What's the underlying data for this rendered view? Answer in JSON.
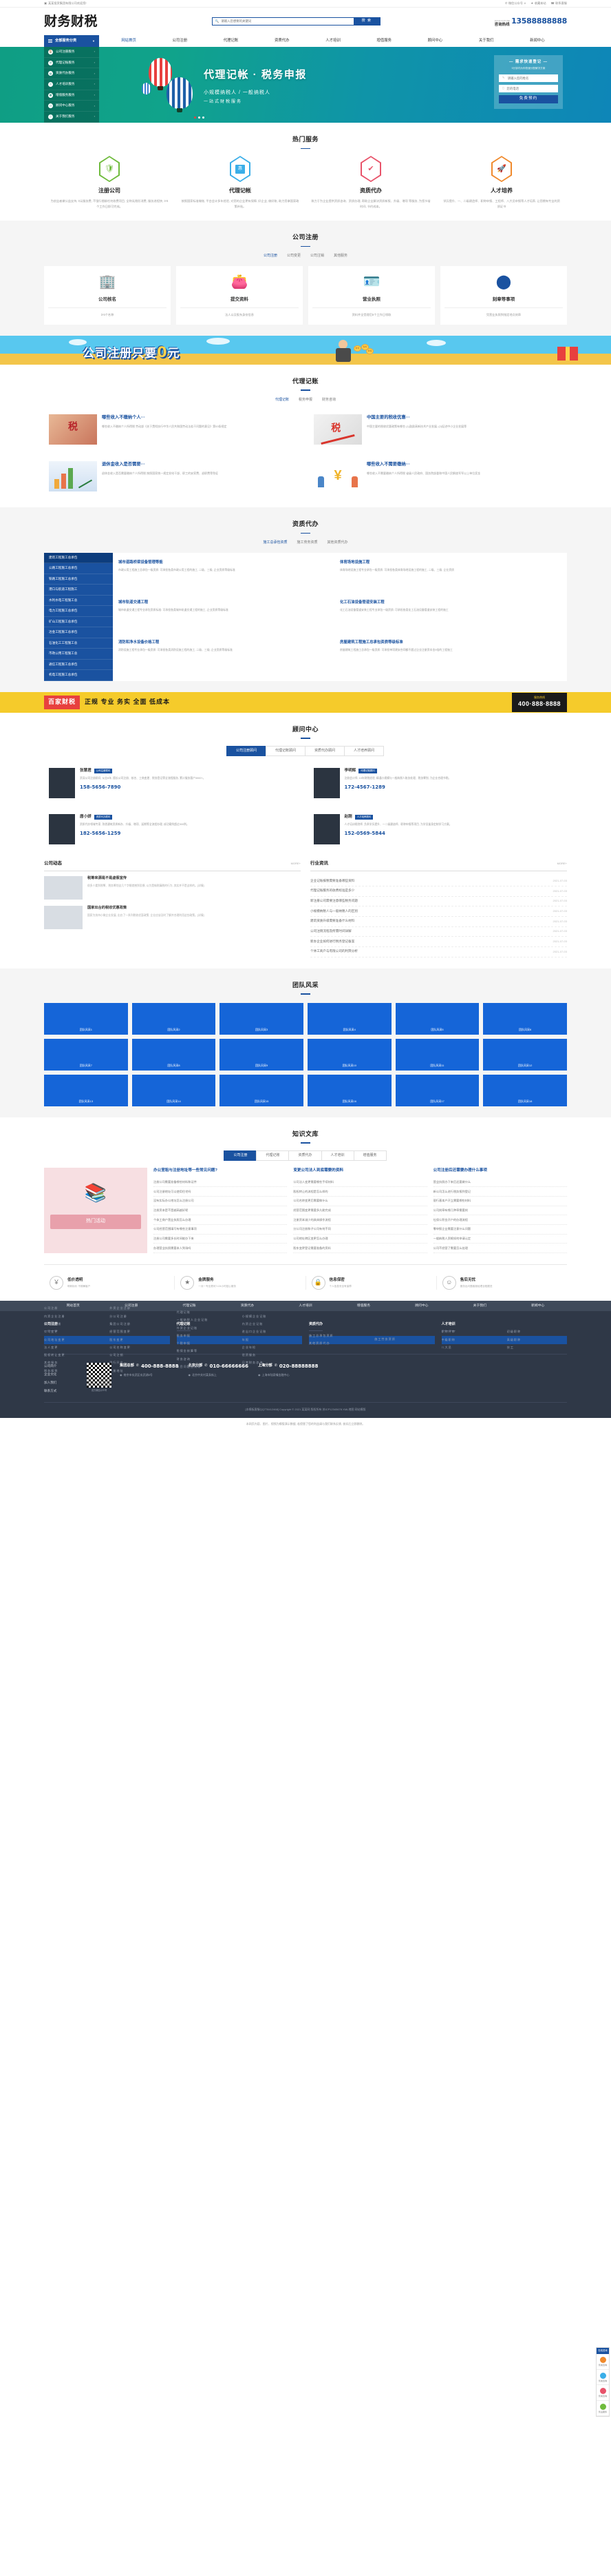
{
  "topbar": {
    "welcome": "某某投资集团有限公司欢迎您!",
    "links": [
      {
        "label": "微信公众号",
        "icon": "wechat-icon",
        "caret": "∨"
      },
      {
        "label": "收藏本站",
        "icon": "star-icon"
      },
      {
        "label": "联系客服",
        "icon": "headset-icon"
      }
    ]
  },
  "header": {
    "logo": "财务财税",
    "search": {
      "placeholder": "请输入您想要的关键词",
      "button": "搜 索",
      "icon": "search-icon"
    },
    "hotline": {
      "en": "ADICE HOTLINE",
      "cn": "咨询热线",
      "number": "13588888888"
    }
  },
  "nav": {
    "category_button": "全部服务分类",
    "links": [
      {
        "label": "网站首页",
        "active": true
      },
      {
        "label": "公司注册"
      },
      {
        "label": "代理记账"
      },
      {
        "label": "资质代办"
      },
      {
        "label": "人才培训"
      },
      {
        "label": "增值服务"
      },
      {
        "label": "顾问中心"
      },
      {
        "label": "关于我们"
      },
      {
        "label": "新闻中心"
      }
    ]
  },
  "hero": {
    "categories": [
      {
        "label": "公司注册服务",
        "icon": "building-icon"
      },
      {
        "label": "代理记账服务",
        "icon": "ledger-icon"
      },
      {
        "label": "资质代办服务",
        "icon": "certificate-icon"
      },
      {
        "label": "人才培训服务",
        "icon": "person-icon"
      },
      {
        "label": "增值服务服务",
        "icon": "grid-icon"
      },
      {
        "label": "顾问中心服务",
        "icon": "advisor-icon"
      },
      {
        "label": "关于我们服务",
        "icon": "info-icon"
      }
    ],
    "title": "代理记帐 · 税务申报",
    "subtitle": "小规模纳税人 / 一般纳税人",
    "subtitle2": "一站式财税服务",
    "form": {
      "title": "— 需求快速登记 —",
      "tip": "5分钟内为你快速分配解决方案",
      "name_placeholder": "请输入您的姓名",
      "phone_placeholder": "您的电话",
      "submit": "免费预约",
      "name_icon": "pen-icon",
      "phone_icon": "phone-icon"
    },
    "dots": 3
  },
  "hot_services": {
    "title": "热门服务",
    "items": [
      {
        "name": "注册公司",
        "icon": "shield-icon",
        "glyph": "🛡",
        "color": "#6fbb3c",
        "desc": "为创业者做公益支持, 0元服务费, 不强行捆绑任何收费项目, 全称无隐形消费, 服务进程快, 3-5个工作日即可完成。"
      },
      {
        "name": "代理记帐",
        "icon": "ticket-icon",
        "glyph": "惠",
        "color": "#3aaee8",
        "desc": "按照国家标准做账, 平台会计多年经验, 对您的企业更有保障, 好企业, 做好账, 助力您拿国家政策补贴。"
      },
      {
        "name": "资质代办",
        "icon": "medal-icon",
        "glyph": "✔",
        "color": "#e8536a",
        "desc": "致力于为企业提供资质咨询、资质办理, 帮助企业解决资质新报、升级、增项 等服务, 为您节省时间, 节约成本。"
      },
      {
        "name": "人才培养",
        "icon": "rocket-icon",
        "glyph": "🚀",
        "color": "#f08a2c",
        "desc": "学历提升、一、二级建造师、职称申报、工程师、八大员申报等人才培养, 让您拥有专业的资质证书"
      }
    ]
  },
  "company_register": {
    "title": "公司注册",
    "tabs": [
      "公司注册",
      "公司变更",
      "公司注销",
      "其他服务"
    ],
    "cards": [
      {
        "title": "公司核名",
        "desc": "3-5个名称",
        "icon": "building-icon",
        "glyph": "🏢"
      },
      {
        "title": "提交资料",
        "desc": "法人以及股东身份信息",
        "icon": "wallet-icon",
        "glyph": "👛"
      },
      {
        "title": "营业执照",
        "desc": "资料齐全受理后5个工作日领取",
        "icon": "license-icon",
        "glyph": "🪪"
      },
      {
        "title": "刻章等事项",
        "desc": "凭营业执照到指定地点刻章",
        "icon": "stamp-icon",
        "glyph": "🏷"
      }
    ]
  },
  "promo_banner": {
    "text_main": "公司注册只要",
    "text_zero": "0",
    "text_unit": "元"
  },
  "bookkeeping": {
    "title": "代理记账",
    "tabs": [
      "代理记账",
      "税务申报",
      "财务咨询"
    ],
    "articles": [
      {
        "title": "哪些收入不缴纳个人···",
        "desc": "哪些收入不缴纳个人所得税 劳动部《关于贯彻执行中华人民共和国劳动法若干问题的意见》第53条规定",
        "thumb": "hands-tax-image"
      },
      {
        "title": "中国主要的税收优惠···",
        "desc": "中国主要的税收优惠政策有哪些 (1)鼓励高新技术产业发展; (2)促进中小企业发展等",
        "thumb": "tax-climb-image"
      },
      {
        "title": "退休金收入是否需要···",
        "desc": "退休金收入是否需要缴纳个人所得税 按照国家统一规定发给干部、职工的安家费、退职费等免征",
        "thumb": "growth-chart-image"
      },
      {
        "title": "哪些收入不需要缴纳···",
        "desc": "哪些收入不需要缴纳个人所得税 省级人民政府、国务院部委和中国人民解放军军以上单位奖金",
        "thumb": "yen-people-image"
      }
    ]
  },
  "qualification": {
    "title": "资质代办",
    "tabs": [
      "施工总承包资质",
      "施工劳务资质",
      "其他资质代办"
    ],
    "left_menu": [
      {
        "label": "建筑工程施工总承包",
        "active": true
      },
      {
        "label": "公路工程施工总承包"
      },
      {
        "label": "铁路工程施工总承包"
      },
      {
        "label": "港口与航道工程施工"
      },
      {
        "label": "水利水电工程施工总"
      },
      {
        "label": "电力工程施工总承包"
      },
      {
        "label": "矿山工程施工总承包"
      },
      {
        "label": "冶金工程施工总承包"
      },
      {
        "label": "石油化工工程施工总"
      },
      {
        "label": "市政公用工程施工总"
      },
      {
        "label": "通信工程施工总承包"
      },
      {
        "label": "机电工程施工总承包"
      }
    ],
    "items": [
      {
        "title": "城市道路桥梁设备管理等能",
        "desc": "市政公用工程施工总承包一级资质: 可承担各类市政公用工程的施工, 二级、三级, 企业资质等级标准"
      },
      {
        "title": "体育场地设施工程",
        "desc": "体育场地设施工程专业承包一级资质: 可承担各类体育场地设施工程的施工, 二级、三级, 企业资质"
      },
      {
        "title": "城市轨道交通工程",
        "desc": "城市轨道交通工程专业承包资质标准: 可承担各类城市轨道交通工程的施工, 企业资质等级标准"
      },
      {
        "title": "化工石油设备管道安装工程",
        "desc": "化工石油设备管道安装工程专业承包一级资质: 可承担各类化工石油设备管道安装工程的施工"
      },
      {
        "title": "消防和净水设备价格工程",
        "desc": "消防设施工程专业承包一级资质: 可承担各类消防设施工程的施工, 二级、三级, 企业资质等级标准"
      },
      {
        "title": "房屋建筑工程施工总承包资质等级标准",
        "desc": "房屋建筑工程施工总承包一级资质: 可承担单项建安合同额不超过企业注册资本金5倍的工程施工"
      }
    ]
  },
  "brand_bar": {
    "logo": "百家财税",
    "slogan": "正规 专业 务实 全面 低成本",
    "hotline_label": "服务热线",
    "hotline_number": "400·888·8888"
  },
  "consultants": {
    "title": "顾问中心",
    "tabs": [
      "公司注册顾问",
      "代理记账顾问",
      "资质代办顾问",
      "人才培养顾问"
    ],
    "items": [
      {
        "name": "张慧君",
        "tag": "公司注册顾问",
        "phone": "158-5656-7890",
        "desc": "资深公司注册顾问, 从业8年, 擅长公司注册、核名、工商变更、税务登记等全流程服务, 累计服务客户3000+。"
      },
      {
        "name": "李明辉",
        "tag": "代理记账顾问",
        "phone": "172-4567-1289",
        "desc": "注册会计师, 10年财税经验, 精通小规模与一般纳税人账务处理、税务筹划, 为企业合理节税。"
      },
      {
        "name": "唐小妍",
        "tag": "资质代办顾问",
        "phone": "182-5656-1259",
        "desc": "资质代办领域专家, 熟悉建筑资质新办、升级、增项、延期等全流程办理, 成功案例超过500例。"
      },
      {
        "name": "赵刚",
        "tag": "人才培养顾问",
        "phone": "152-0569-5844",
        "desc": "人才培训规划师, 负责学历提升、一二级建造师、职称申报等项目, 为学员量身定制学习方案。"
      }
    ]
  },
  "company_news": {
    "title": "公司动态",
    "more": "MORE+",
    "items": [
      {
        "title": "税筹来源是不是虚假宣传",
        "desc": "很多人看到税筹、税务筹划这几个字眼就感到恐惧, 以为是偷税漏税的行为, 其实并不是这样的。[详情]",
        "thumb": "office-image"
      },
      {
        "title": "国家出台的税收优惠政策",
        "desc": "国家为扶持小微企业发展, 出台了一系列税收优惠政策, 企业应该及时了解并合理利用这些政策。[详情]",
        "thumb": "lightbulb-image"
      }
    ]
  },
  "industry_news": {
    "title": "行业资讯",
    "more": "MORE+",
    "items": [
      {
        "title": "企业记账报税需要准备哪些资料",
        "date": "2021-07-03"
      },
      {
        "title": "代理记账服务的收费标准是多少",
        "date": "2021-07-03"
      },
      {
        "title": "新注册公司需要注意哪些税务问题",
        "date": "2021-07-03"
      },
      {
        "title": "小规模纳税人与一般纳税人的区别",
        "date": "2021-07-03"
      },
      {
        "title": "建筑资质升级需要准备什么材料",
        "date": "2021-07-03"
      },
      {
        "title": "公司注销流程及所需时间详解",
        "date": "2021-07-03"
      },
      {
        "title": "新办企业如何进行税务登记备案",
        "date": "2021-07-03"
      },
      {
        "title": "个体工商户与有限公司的利弊分析",
        "date": "2021-07-03"
      }
    ]
  },
  "team": {
    "title": "团队风采",
    "cells": [
      {
        "caption": "团队风采1"
      },
      {
        "caption": "团队风采2"
      },
      {
        "caption": "团队风采3"
      },
      {
        "caption": "团队风采4"
      },
      {
        "caption": "团队风采5"
      },
      {
        "caption": "团队风采6"
      },
      {
        "caption": "团队风采7"
      },
      {
        "caption": "团队风采8"
      },
      {
        "caption": "团队风采9"
      },
      {
        "caption": "团队风采10"
      },
      {
        "caption": "团队风采11"
      },
      {
        "caption": "团队风采12"
      },
      {
        "caption": "团队风采13"
      },
      {
        "caption": "团队风采14"
      },
      {
        "caption": "团队风采15"
      },
      {
        "caption": "团队风采16"
      },
      {
        "caption": "团队风采17"
      },
      {
        "caption": "团队风采18"
      }
    ]
  },
  "knowledge": {
    "title": "知识文库",
    "tabs": [
      {
        "label": "公司注册",
        "active": true
      },
      {
        "label": "代理记账"
      },
      {
        "label": "资质代办"
      },
      {
        "label": "人才培训"
      },
      {
        "label": "增值服务"
      }
    ],
    "promo_button": "热门活动",
    "promo_icon": "books-icon",
    "columns": [
      {
        "heading": "办公室租与注册地址等一些常见问题?",
        "items": [
          "注册公司需要准备哪些材料和证件",
          "公司注册地址可以使用住宅吗",
          "没有实际办公地址怎么注册公司",
          "注册资本是不是越高越好呢",
          "个体工商户营业执照怎么办理",
          "公司经营范围填写有哪些注意事项",
          "注册公司需要多长时间能办下来",
          "办理营业执照需要本人到场吗"
        ]
      },
      {
        "heading": "变更公司法人到底需要的资料",
        "items": [
          "公司法人变更需要哪些手续材料",
          "股权转让的流程是怎么样的",
          "公司名称变更后需要做什么",
          "经营范围变更需要多久能完成",
          "注册资本减少的具体操作流程",
          "分公司注册和子公司有何不同",
          "公司地址跨区变更怎么办理",
          "股东变更登记需要准备的资料"
        ]
      },
      {
        "heading": "公司注册后还需要办理什么事项",
        "items": [
          "营业执照办下来后还要做什么",
          "新公司怎么进行税务报到登记",
          "银行基本户开立需要哪些材料",
          "公司刻章有哪几种章需要刻",
          "社保公积金开户的办理流程",
          "零申报企业需要注意什么问题",
          "一般纳税人资格如何申请认定",
          "公司不经营了需要怎么处理"
        ]
      }
    ]
  },
  "advantages": [
    {
      "title": "低价透明",
      "desc": "明码标价 不欺瞒客户",
      "icon": "price-icon",
      "glyph": "￥"
    },
    {
      "title": "金牌服务",
      "desc": "一对一专业顾问7×24小时贴心服务",
      "icon": "medal-icon",
      "glyph": "★"
    },
    {
      "title": "信息保密",
      "desc": "个人信息安全有保障",
      "icon": "lock-icon",
      "glyph": "🔒"
    },
    {
      "title": "售后无忧",
      "desc": "服务出问题客服经理全程跟进",
      "icon": "support-icon",
      "glyph": "☺"
    }
  ],
  "footer": {
    "nav": [
      "网站首页",
      "公司注册",
      "代理记账",
      "资质代办",
      "人才培训",
      "增值服务",
      "顾问中心",
      "关于我们",
      "新闻中心"
    ],
    "columns": [
      {
        "heading": "公司注册",
        "lists": [
          [
            "公司注册",
            "内资企业注册",
            "子公司注册",
            "公司变更",
            "公司地址变更",
            "法人变更",
            "股权转让变更",
            "其他服务",
            "税务报到"
          ],
          [
            "外资企业注册",
            "分公司注册",
            "集团公司注册",
            "经营范围变更",
            "股东变更",
            "公司名称变更",
            "公司注销",
            "银行开户",
            "注册地址"
          ]
        ]
      },
      {
        "heading": "代理记账",
        "lists": [
          [
            "代理记账",
            "一般纳税人企业记账",
            "外资企业记账",
            "税务申报",
            "个税申报",
            "税保金核算等",
            "财务咨询",
            "账目问题咨询等"
          ],
          [
            "小规模企业记账",
            "内资企业记账",
            "进出口企业记账",
            "年报",
            "企业年检",
            "验资服务",
            "日常财务咨询"
          ]
        ]
      },
      {
        "heading": "资质代办",
        "lists": [
          [
            "施工总承包资质",
            "其他资质代办"
          ],
          [
            "施工劳务资质"
          ]
        ]
      },
      {
        "heading": "人才培训",
        "lists": [
          [
            "职称评审",
            "中级职称",
            "八大员"
          ],
          [
            "初级职称",
            "高级职称",
            "技工"
          ]
        ]
      }
    ],
    "quick_links": [
      "公司简介",
      "企业文化",
      "加入我们",
      "联系方式"
    ],
    "qr_caption": "官方微信公众号",
    "contacts": [
      {
        "label": "集团总部",
        "phone": "400-888-8888",
        "address": "南京市玄武区玄武湖8号"
      },
      {
        "label": "北京分部",
        "phone": "010-66666666",
        "address": "北京中关村某条街上"
      },
      {
        "label": "上海分部",
        "phone": "020-88888888",
        "address": "上海市陆家嘴金融中心"
      }
    ],
    "copyright": "[本模板客服QQ778412468] Copyright © 2021 某某网 版权所有  苏ICP12345678  XML地图  网站模版",
    "disclaimer": "本网页内容、图片、视频为模版演示数据, 若侵害了您的利益请与我们联系反馈, 核实后立即删除。"
  },
  "side_widget": {
    "header": "在线咨询",
    "items": [
      {
        "label": "售前咨询",
        "color": "#f08a2c"
      },
      {
        "label": "售前咨询",
        "color": "#3aaee8"
      },
      {
        "label": "售前咨询",
        "color": "#e8536a"
      },
      {
        "label": "售后服务",
        "color": "#6fbb3c"
      }
    ]
  }
}
